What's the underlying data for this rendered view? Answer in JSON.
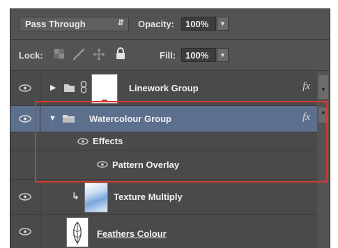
{
  "toolbar": {
    "blend_mode": "Pass Through",
    "opacity_label": "Opacity:",
    "opacity_value": "100%",
    "lock_label": "Lock:",
    "fill_label": "Fill:",
    "fill_value": "100%"
  },
  "layers": [
    {
      "name": "Linework Group",
      "type": "group",
      "expanded": false,
      "has_fx": true,
      "fx_label": "fx"
    },
    {
      "name": "Watercolour Group",
      "type": "group",
      "expanded": true,
      "selected": true,
      "has_fx": true,
      "fx_label": "fx"
    },
    {
      "name": "Effects",
      "type": "effects-header"
    },
    {
      "name": "Pattern Overlay",
      "type": "effect"
    },
    {
      "name": "Texture Multiply",
      "type": "layer",
      "clipped": true
    },
    {
      "name": "Feathers Colour",
      "type": "layer"
    }
  ],
  "colors": {
    "panel_bg": "#4a4a4a",
    "selected_bg": "#5c6f8c",
    "highlight_frame": "#d33b2c"
  }
}
